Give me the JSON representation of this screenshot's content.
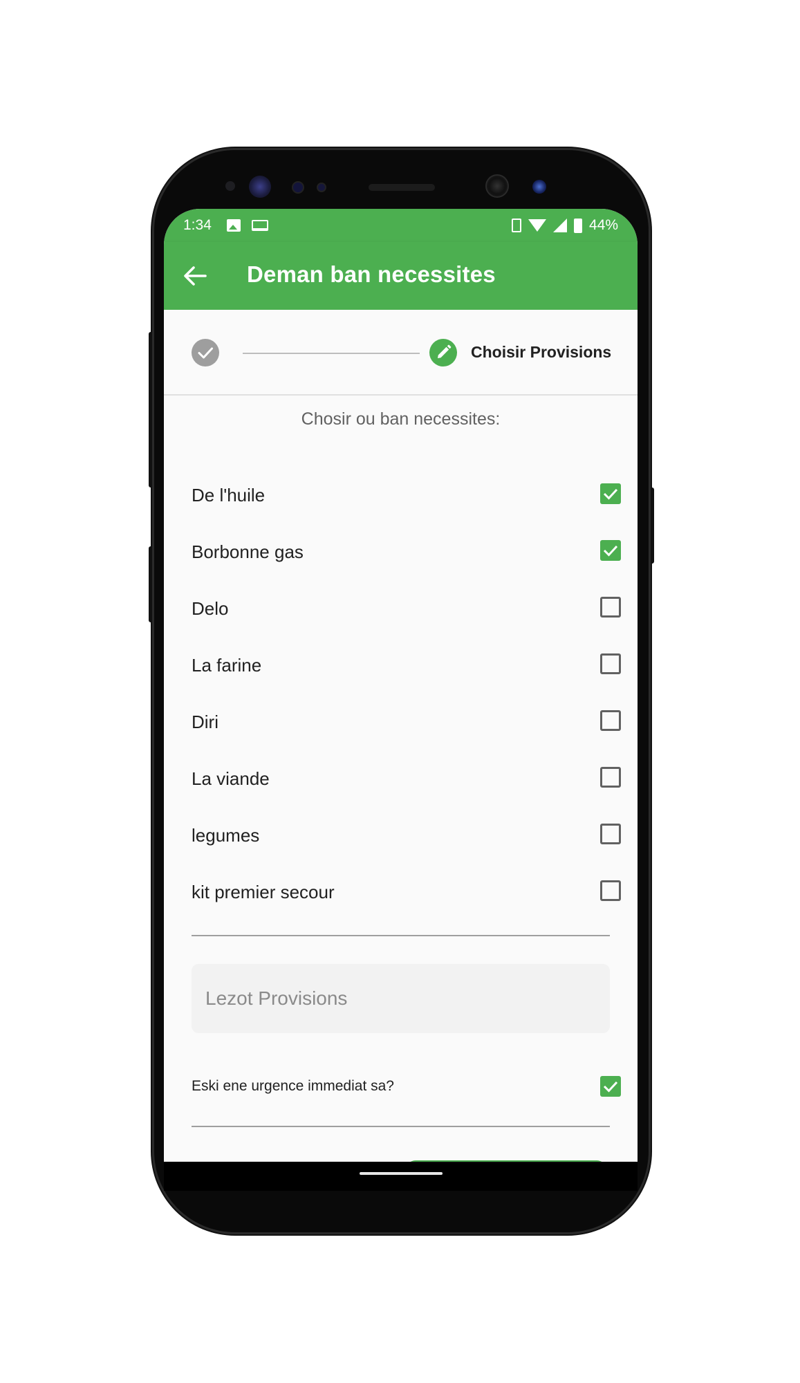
{
  "status_bar": {
    "time": "1:34",
    "battery": "44%",
    "icons": [
      "image-icon",
      "laptop-icon",
      "vibrate-icon",
      "wifi-icon",
      "signal-icon",
      "battery-icon"
    ]
  },
  "app_bar": {
    "title": "Deman ban necessites",
    "back_icon": "arrow-left-icon",
    "color": "#4caf50"
  },
  "stepper": {
    "completed_step_icon": "check-icon",
    "active_step_icon": "pencil-icon",
    "active_step_label": "Choisir Provisions"
  },
  "section_title": "Chosir ou ban necessites:",
  "items": [
    {
      "label": "De l'huile",
      "checked": true
    },
    {
      "label": "Borbonne gas",
      "checked": true
    },
    {
      "label": "Delo",
      "checked": false
    },
    {
      "label": "La farine",
      "checked": false
    },
    {
      "label": "Diri",
      "checked": false
    },
    {
      "label": "La viande",
      "checked": false
    },
    {
      "label": "legumes",
      "checked": false
    },
    {
      "label": "kit premier secour",
      "checked": false
    }
  ],
  "other_field": {
    "placeholder": "Lezot Provisions"
  },
  "urgent": {
    "label": "Eski ene urgence immediat sa?",
    "checked": true
  }
}
